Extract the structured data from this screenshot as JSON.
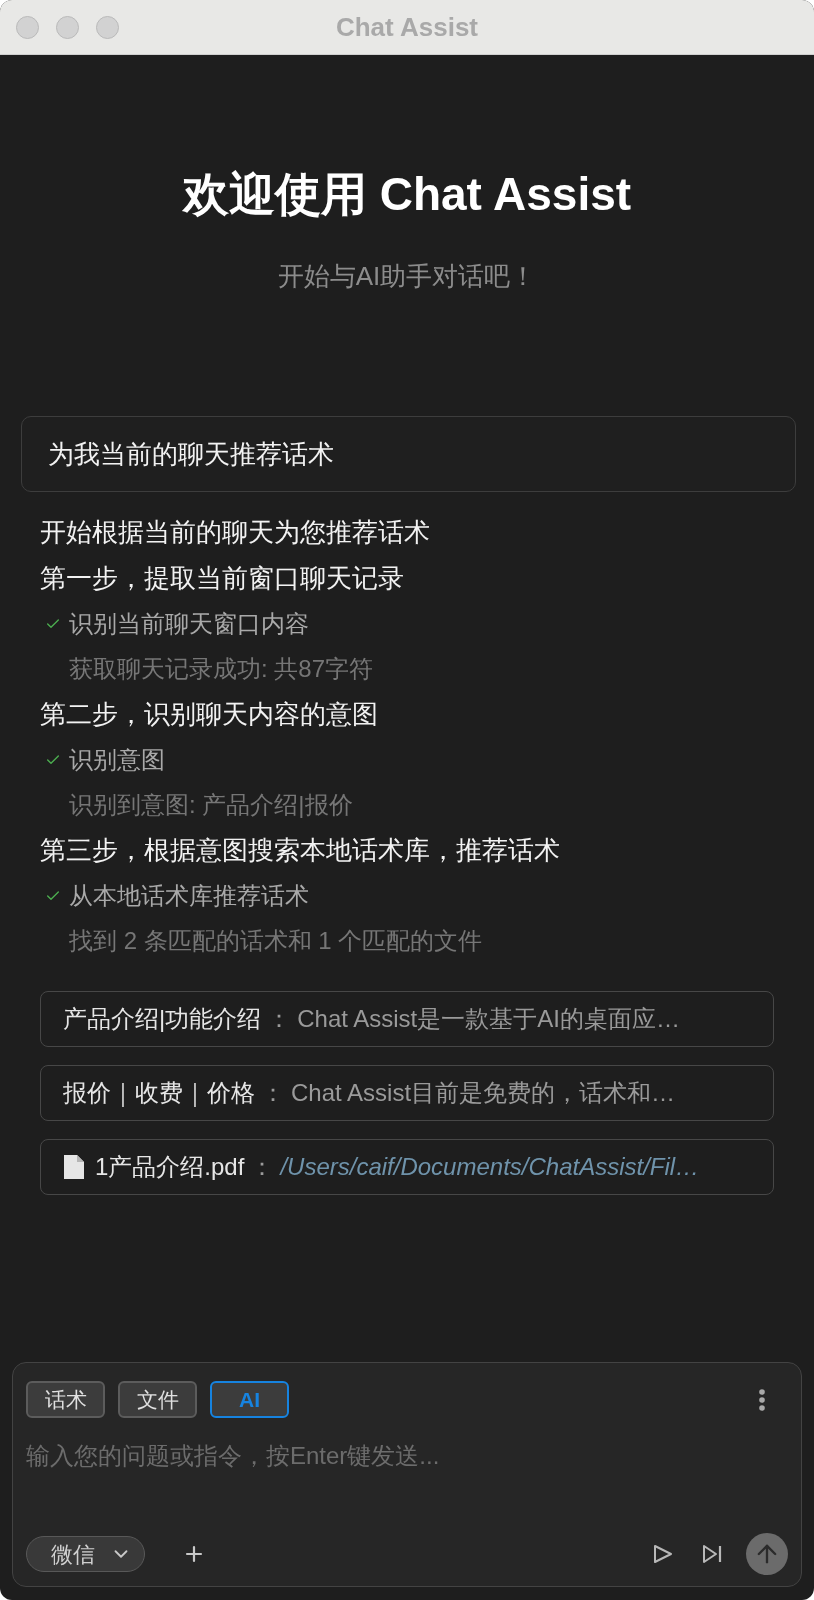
{
  "window": {
    "title": "Chat Assist"
  },
  "welcome": {
    "title": "欢迎使用 Chat Assist",
    "subtitle": "开始与AI助手对话吧！"
  },
  "user_message": {
    "text": "为我当前的聊天推荐话术"
  },
  "progress": [
    {
      "kind": "heading",
      "text": "开始根据当前的聊天为您推荐话术"
    },
    {
      "kind": "heading",
      "text": "第一步，提取当前窗口聊天记录"
    },
    {
      "kind": "task",
      "text": "识别当前聊天窗口内容",
      "done": true
    },
    {
      "kind": "result",
      "text": "获取聊天记录成功: 共87字符"
    },
    {
      "kind": "heading",
      "text": "第二步，识别聊天内容的意图"
    },
    {
      "kind": "task",
      "text": "识别意图",
      "done": true
    },
    {
      "kind": "result",
      "text": "识别到意图: 产品介绍|报价"
    },
    {
      "kind": "heading",
      "text": "第三步，根据意图搜索本地话术库，推荐话术"
    },
    {
      "kind": "task",
      "text": "从本地话术库推荐话术",
      "done": true
    },
    {
      "kind": "result",
      "text": "找到 2 条匹配的话术和 1 个匹配的文件"
    }
  ],
  "matches": [
    {
      "kind": "script",
      "label": "产品介绍|功能介绍",
      "separator": "：",
      "value": "Chat Assist是一款基于AI的桌面应…"
    },
    {
      "kind": "script",
      "label": "报价｜收费｜价格",
      "separator": "：",
      "value": "Chat Assist目前是免费的，话术和…"
    },
    {
      "kind": "file",
      "label": "1产品介绍.pdf",
      "separator": "：",
      "value": "/Users/caif/Documents/ChatAssist/Fil…"
    }
  ],
  "composer": {
    "tabs": [
      {
        "label": "话术",
        "selected": false
      },
      {
        "label": "文件",
        "selected": false
      },
      {
        "label": "AI",
        "selected": true
      }
    ],
    "placeholder": "输入您的问题或指令，按Enter键发送...",
    "channel": {
      "value": "微信"
    }
  }
}
